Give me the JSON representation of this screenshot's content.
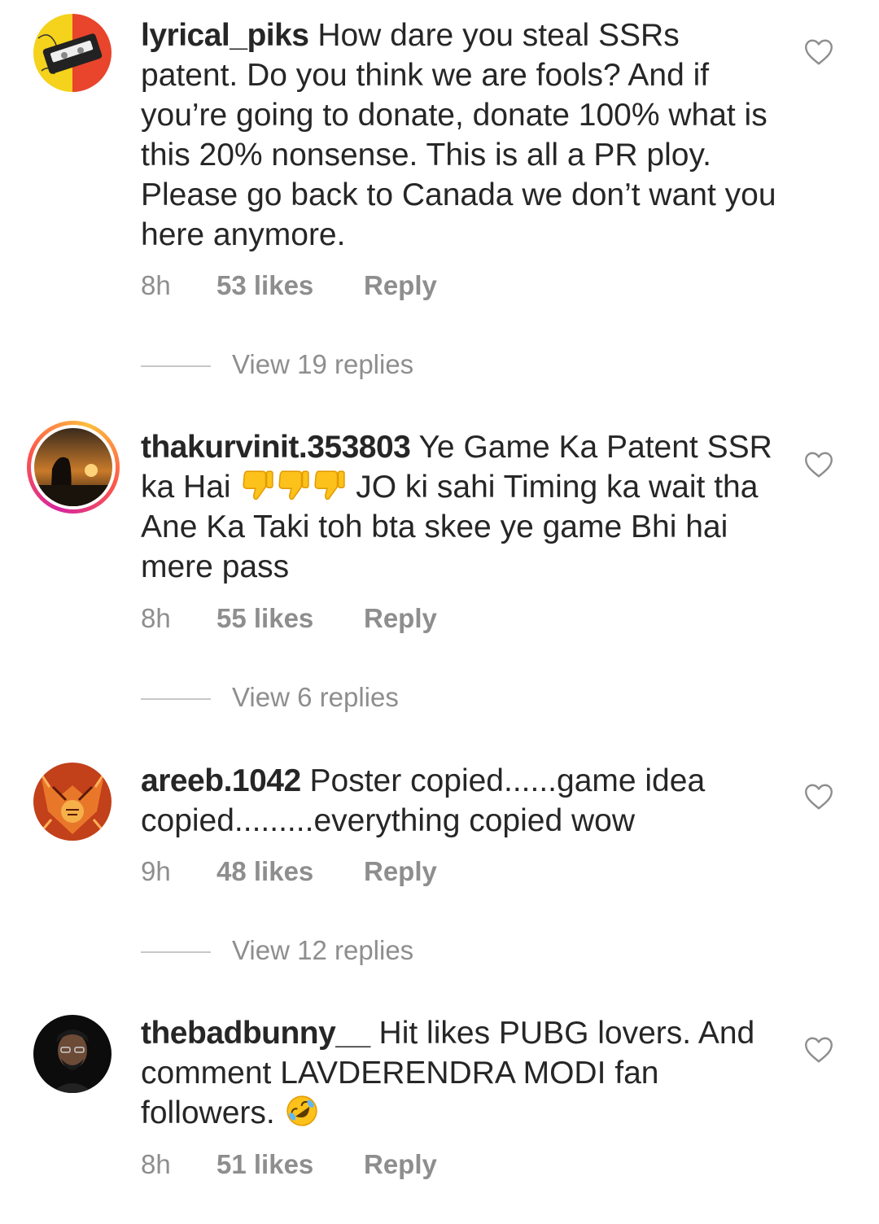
{
  "comments": [
    {
      "username": "lyrical_piks",
      "text": "How dare you steal SSRs patent. Do you think we are fools? And if you’re going to donate, donate 100% what is this 20% nonsense. This is all a PR ploy. Please go back to Canada we don’t want you here anymore.",
      "time": "8h",
      "likes": "53 likes",
      "reply": "Reply",
      "view_replies": "View 19 replies"
    },
    {
      "username": "thakurvinit.353803",
      "text_before_emoji": "Ye Game Ka Patent SSR ka Hai",
      "emojis": [
        "thumbs-down",
        "thumbs-down",
        "thumbs-down"
      ],
      "text_after_emoji": "JO ki sahi Timing ka wait tha Ane Ka Taki toh bta skee ye game Bhi hai mere pass",
      "time": "8h",
      "likes": "55 likes",
      "reply": "Reply",
      "view_replies": "View 6 replies"
    },
    {
      "username": "areeb.1042",
      "text": "Poster copied......game idea copied.........everything copied wow",
      "time": "9h",
      "likes": "48 likes",
      "reply": "Reply",
      "view_replies": "View 12 replies"
    },
    {
      "username": "thebadbunny__",
      "text": "Hit likes PUBG lovers. And comment LAVDERENDRA MODI fan followers.",
      "emojis": [
        "rolling-on-floor-laughing"
      ],
      "time": "8h",
      "likes": "51 likes",
      "reply": "Reply"
    }
  ],
  "icons": {
    "like": "heart-outline-icon"
  },
  "colors": {
    "text": "#262626",
    "secondary": "#8e8e8e",
    "divider": "#c7c7c7",
    "story_ring": [
      "#d6249f",
      "#fd5949",
      "#fdbe3c"
    ]
  }
}
